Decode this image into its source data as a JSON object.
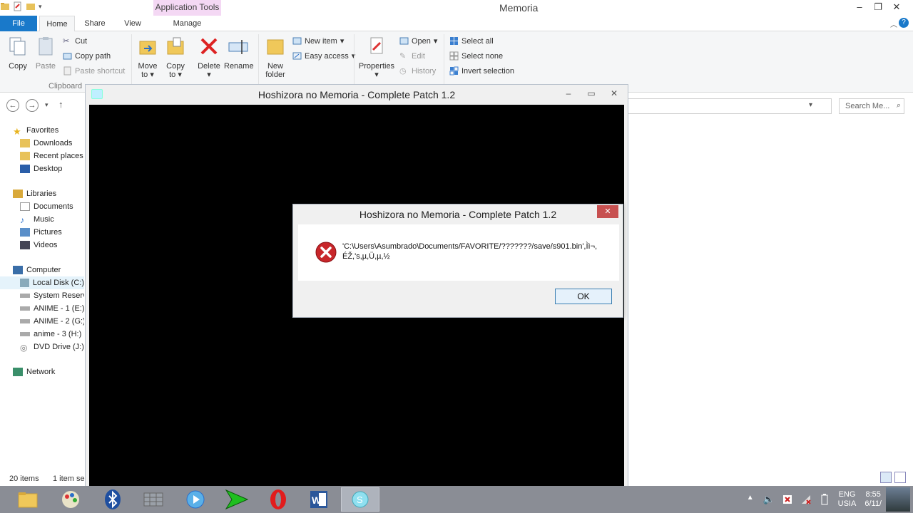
{
  "explorer": {
    "title": "Memoria",
    "app_tools": "Application Tools",
    "tabs": {
      "file": "File",
      "home": "Home",
      "share": "Share",
      "view": "View",
      "manage": "Manage"
    },
    "ribbon": {
      "copy": "Copy",
      "paste": "Paste",
      "cut": "Cut",
      "copy_path": "Copy path",
      "paste_shortcut": "Paste shortcut",
      "clipboard_group": "Clipboard",
      "move_to": "Move",
      "move_to_2": "to",
      "copy_to": "Copy",
      "copy_to_2": "to",
      "delete": "Delete",
      "rename": "Rename",
      "new_folder": "New",
      "new_folder_2": "folder",
      "new_item": "New item",
      "easy_access": "Easy access",
      "properties": "Properties",
      "open": "Open",
      "edit": "Edit",
      "history": "History",
      "select_all": "Select all",
      "select_none": "Select none",
      "invert_selection": "Invert selection"
    },
    "search_placeholder": "Search Me...",
    "nav": {
      "favorites": "Favorites",
      "downloads": "Downloads",
      "recent_places": "Recent places",
      "desktop": "Desktop",
      "libraries": "Libraries",
      "documents": "Documents",
      "music": "Music",
      "pictures": "Pictures",
      "videos": "Videos",
      "computer": "Computer",
      "local_disk": "Local Disk (C:)",
      "system_reserved": "System Reserve",
      "anime1": "ANIME - 1 (E:)",
      "anime2": "ANIME - 2 (G:)",
      "anime3": "anime - 3 (H:)",
      "dvd": "DVD Drive (J:) N",
      "network": "Network"
    },
    "status": {
      "items": "20 items",
      "selected": "1 item se"
    }
  },
  "game_window": {
    "title": "Hoshizora no Memoria - Complete Patch 1.2"
  },
  "dialog": {
    "title": "Hoshizora no Memoria - Complete Patch 1.2",
    "message_line1": "'C:\\Users\\Asumbrado\\Documents/FAVORITE/???????/save/s901.bin',Ìì¬,",
    "message_line2": "ÉŽ,'s,µ,Ü,µ,½",
    "ok_label": "OK",
    "close_glyph": "✕"
  },
  "taskbar": {
    "lang_line1": "ENG",
    "lang_line2": "USIA",
    "time": "8:55",
    "date": "6/11/"
  },
  "colors": {
    "file_tab": "#1979ca",
    "app_tools_bg": "#f4d8f4",
    "taskbar": "#8a8d95",
    "dialog_close": "#c75050"
  }
}
